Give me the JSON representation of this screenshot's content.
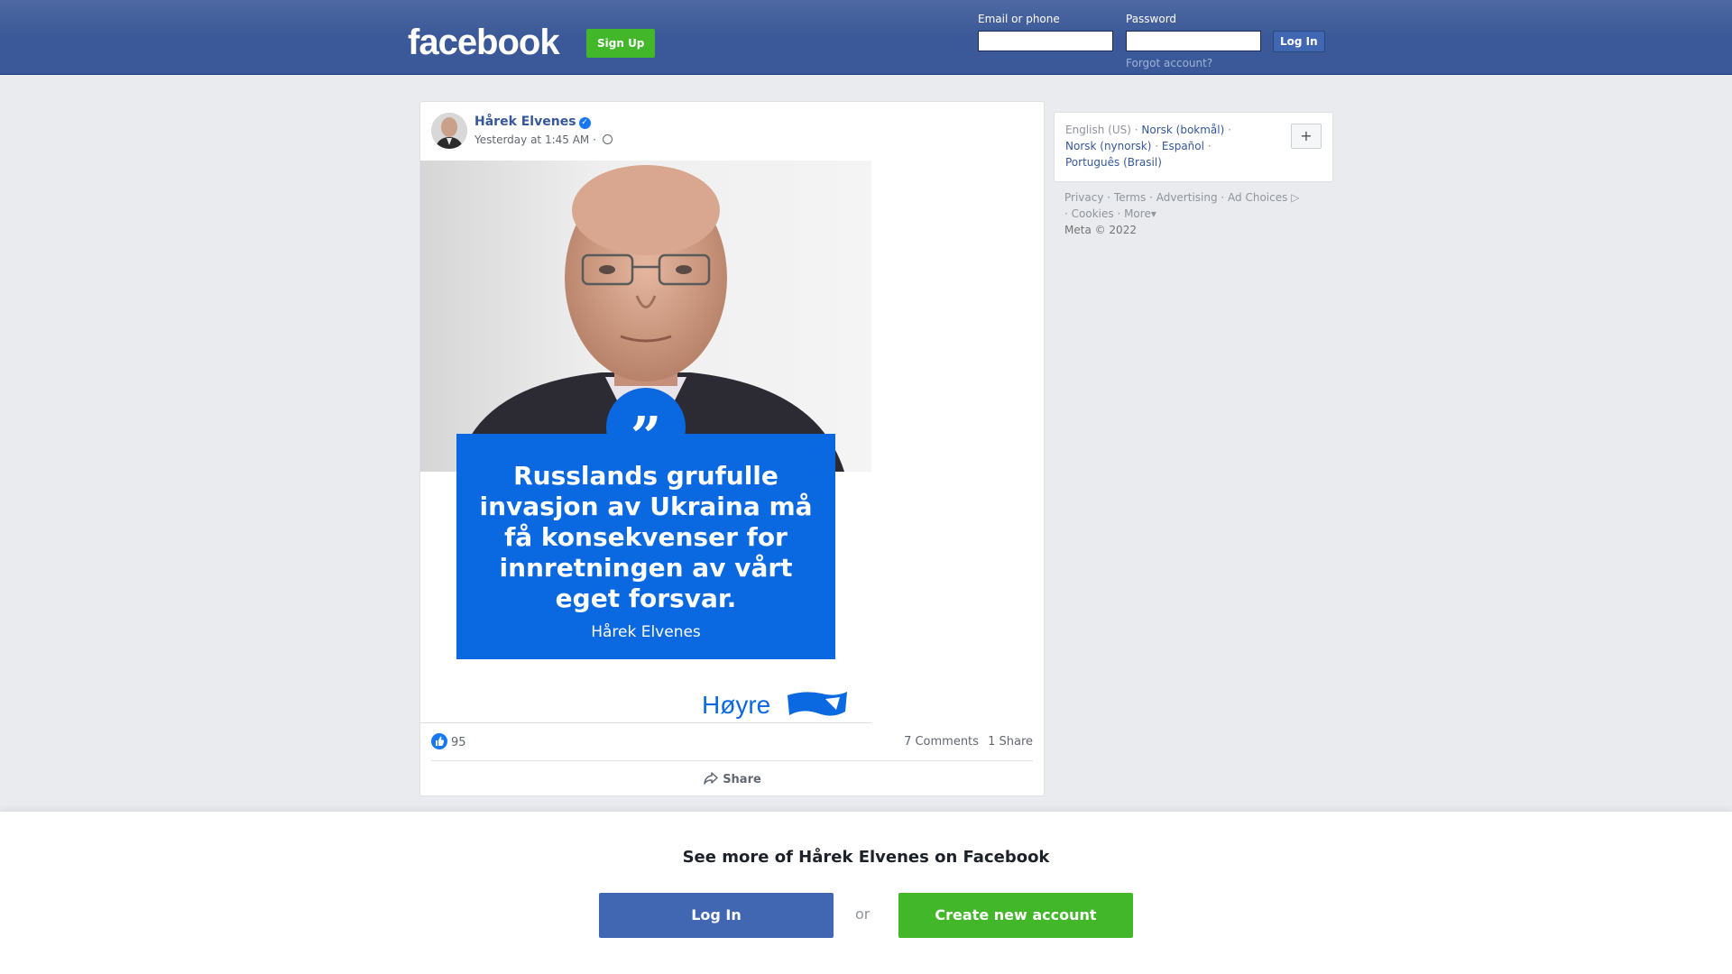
{
  "header": {
    "logo": "facebook",
    "signup_label": "Sign Up",
    "email_label": "Email or phone",
    "password_label": "Password",
    "login_label": "Log In",
    "forgot_label": "Forgot account?",
    "brand_color": "#3b5998"
  },
  "post": {
    "author": "Hårek Elvenes",
    "timestamp": "Yesterday at 1:45 AM",
    "separator": "·",
    "image": {
      "quote_mark": "”",
      "quote_text": "Russlands grufulle invasjon av Ukraina må få konsekvenser for innretningen av vårt eget forsvar.",
      "quote_author": "Hårek Elvenes",
      "party": "Høyre",
      "accent_color": "#0a68e0"
    },
    "reactions_count": "95",
    "comments": "7 Comments",
    "shares": "1 Share",
    "share_action": "Share"
  },
  "sidebar": {
    "languages": [
      {
        "label": "English (US)",
        "link": false
      },
      {
        "label": "Norsk (bokmål)",
        "link": true
      },
      {
        "label": "Norsk (nynorsk)",
        "link": true
      },
      {
        "label": "Español",
        "link": true
      },
      {
        "label": "Português (Brasil)",
        "link": true
      }
    ],
    "add_language": "+",
    "footer": [
      "Privacy",
      "Terms",
      "Advertising",
      "Ad Choices",
      "Cookies",
      "More"
    ],
    "copyright": "Meta © 2022"
  },
  "bottom": {
    "title": "See more of Hårek Elvenes on Facebook",
    "login_label": "Log In",
    "or_label": "or",
    "create_label": "Create new account"
  }
}
